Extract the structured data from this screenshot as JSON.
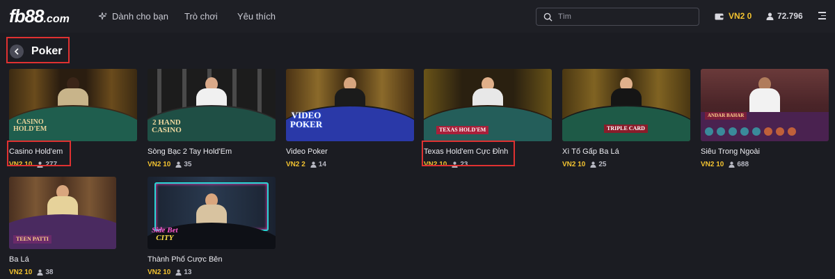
{
  "header": {
    "logo": "fb88",
    "logo_suffix": ".com",
    "nav": [
      {
        "label": "Dành cho bạn"
      },
      {
        "label": "Trò chơi"
      },
      {
        "label": "Yêu thích"
      }
    ],
    "search_placeholder": "Tìm",
    "balance": "VN2 0",
    "online_count": "72.796"
  },
  "section": {
    "title": "Poker"
  },
  "games": [
    {
      "name": "Casino Hold'em",
      "limit": "VN2 10",
      "players": "277",
      "logo_text": "CASINO HOLD'EM"
    },
    {
      "name": "Sòng Bạc 2 Tay Hold'Em",
      "limit": "VN2 10",
      "players": "35",
      "logo_text": "CASINO"
    },
    {
      "name": "Video Poker",
      "limit": "VN2 2",
      "players": "14",
      "logo_text": "VIDEO POKER"
    },
    {
      "name": "Texas Hold'em Cực Đỉnh",
      "limit": "VN2 10",
      "players": "23",
      "logo_text": "TEXAS HOLD'EM"
    },
    {
      "name": "Xì Tố Gấp Ba Lá",
      "limit": "VN2 10",
      "players": "25",
      "logo_text": "TRIPLE CARD"
    },
    {
      "name": "Siêu Trong Ngoài",
      "limit": "VN2 10",
      "players": "688",
      "logo_text": "ANDAR BAHAR"
    },
    {
      "name": "Ba Lá",
      "limit": "VN2 10",
      "players": "38",
      "logo_text": "TEEN PATTI"
    },
    {
      "name": "Thành Phố Cược Bên",
      "limit": "VN2 10",
      "players": "13",
      "logo_text": "Side Bet CITY"
    }
  ],
  "colors": {
    "background": "#1b1c22",
    "accent_gold": "#f2c230",
    "highlight_red": "#e03131"
  },
  "icons": [
    "sparkle-icon",
    "search-icon",
    "wallet-icon",
    "user-icon",
    "menu-icon",
    "chevron-left-icon"
  ]
}
